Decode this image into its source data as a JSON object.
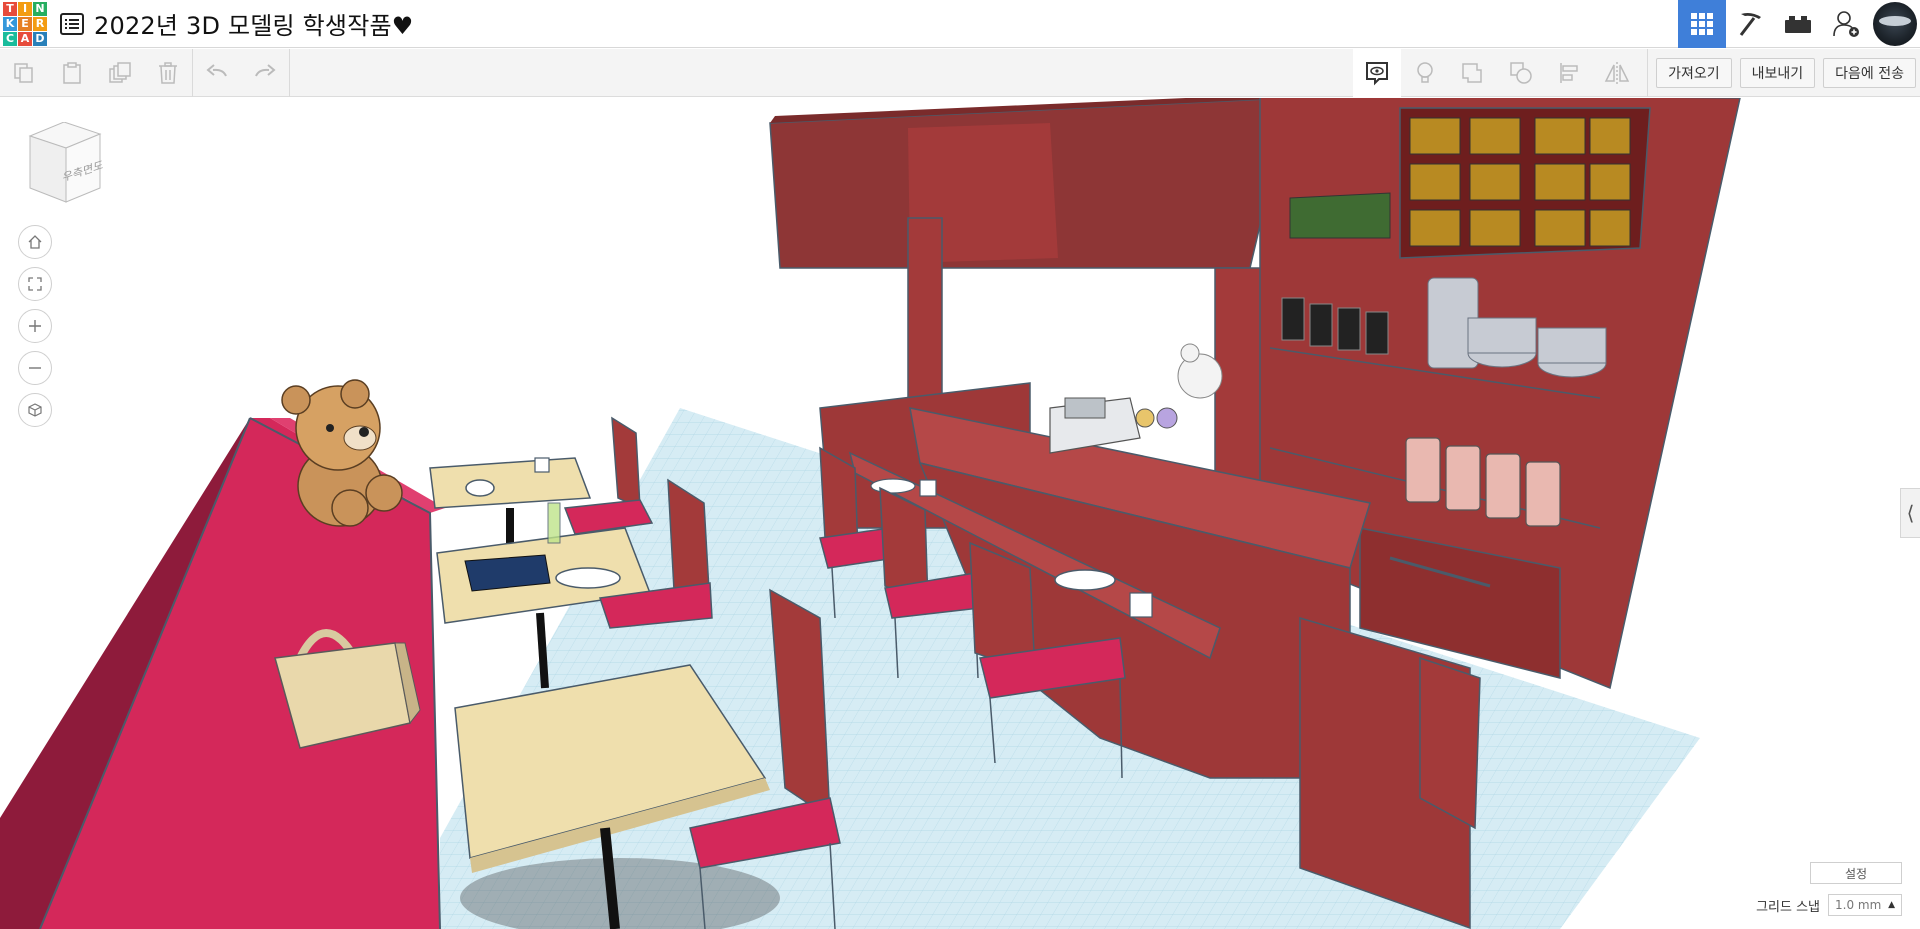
{
  "app": {
    "logo_letters": [
      "T",
      "I",
      "N",
      "K",
      "E",
      "R",
      "C",
      "A",
      "D"
    ],
    "logo_colors": [
      "#e74c3c",
      "#f39c12",
      "#27ae60",
      "#3498db",
      "#e67e22",
      "#f39c12",
      "#1abc9c",
      "#e74c3c",
      "#2980b9"
    ],
    "project_title": "2022년 3D 모델링 학생작품♥"
  },
  "topbar": {
    "buttons": [
      {
        "icon": "grid-view-icon",
        "active": true
      },
      {
        "icon": "pickaxe-icon",
        "active": false
      },
      {
        "icon": "bricks-icon",
        "active": false
      },
      {
        "icon": "add-user-icon",
        "active": false
      }
    ],
    "avatar": "user-avatar"
  },
  "toolbar": {
    "left_tools": [
      "copy-icon",
      "paste-icon",
      "duplicate-icon",
      "delete-icon",
      "undo-icon",
      "redo-icon"
    ],
    "right_tools": [
      "notes-icon",
      "light-bulb-icon",
      "group-icon",
      "ungroup-icon",
      "align-icon",
      "mirror-icon"
    ],
    "import_label": "가져오기",
    "export_label": "내보내기",
    "send_to_label": "다음에 전송"
  },
  "viewport": {
    "viewcube_label": "우측면도",
    "nav_controls": [
      "home-icon",
      "fit-icon",
      "zoom-in-icon",
      "zoom-out-icon",
      "perspective-icon"
    ],
    "settings_label": "설정",
    "grid_snap_label": "그리드 스냅",
    "grid_snap_value": "1.0 mm",
    "colors": {
      "grid_bg": "#cfe8f2",
      "sofa": "#d4285a",
      "table_top": "#efdfad",
      "furniture_red": "#a33a3a",
      "accent_blue": "#3f7fd9"
    }
  }
}
